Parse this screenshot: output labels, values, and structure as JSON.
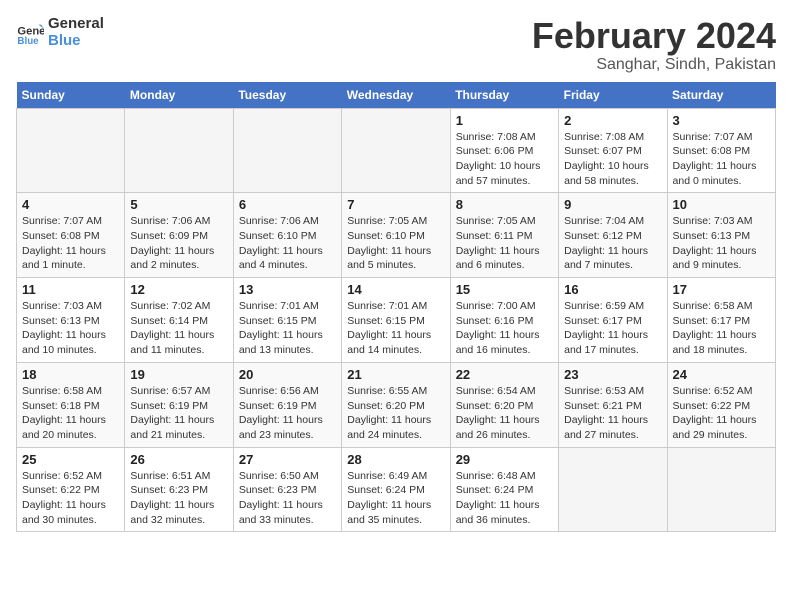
{
  "header": {
    "logo_line1": "General",
    "logo_line2": "Blue",
    "main_title": "February 2024",
    "subtitle": "Sanghar, Sindh, Pakistan"
  },
  "days_of_week": [
    "Sunday",
    "Monday",
    "Tuesday",
    "Wednesday",
    "Thursday",
    "Friday",
    "Saturday"
  ],
  "weeks": [
    [
      {
        "day": "",
        "empty": true
      },
      {
        "day": "",
        "empty": true
      },
      {
        "day": "",
        "empty": true
      },
      {
        "day": "",
        "empty": true
      },
      {
        "day": "1",
        "sunrise": "7:08 AM",
        "sunset": "6:06 PM",
        "daylight": "10 hours and 57 minutes."
      },
      {
        "day": "2",
        "sunrise": "7:08 AM",
        "sunset": "6:07 PM",
        "daylight": "10 hours and 58 minutes."
      },
      {
        "day": "3",
        "sunrise": "7:07 AM",
        "sunset": "6:08 PM",
        "daylight": "11 hours and 0 minutes."
      }
    ],
    [
      {
        "day": "4",
        "sunrise": "7:07 AM",
        "sunset": "6:08 PM",
        "daylight": "11 hours and 1 minute."
      },
      {
        "day": "5",
        "sunrise": "7:06 AM",
        "sunset": "6:09 PM",
        "daylight": "11 hours and 2 minutes."
      },
      {
        "day": "6",
        "sunrise": "7:06 AM",
        "sunset": "6:10 PM",
        "daylight": "11 hours and 4 minutes."
      },
      {
        "day": "7",
        "sunrise": "7:05 AM",
        "sunset": "6:10 PM",
        "daylight": "11 hours and 5 minutes."
      },
      {
        "day": "8",
        "sunrise": "7:05 AM",
        "sunset": "6:11 PM",
        "daylight": "11 hours and 6 minutes."
      },
      {
        "day": "9",
        "sunrise": "7:04 AM",
        "sunset": "6:12 PM",
        "daylight": "11 hours and 7 minutes."
      },
      {
        "day": "10",
        "sunrise": "7:03 AM",
        "sunset": "6:13 PM",
        "daylight": "11 hours and 9 minutes."
      }
    ],
    [
      {
        "day": "11",
        "sunrise": "7:03 AM",
        "sunset": "6:13 PM",
        "daylight": "11 hours and 10 minutes."
      },
      {
        "day": "12",
        "sunrise": "7:02 AM",
        "sunset": "6:14 PM",
        "daylight": "11 hours and 11 minutes."
      },
      {
        "day": "13",
        "sunrise": "7:01 AM",
        "sunset": "6:15 PM",
        "daylight": "11 hours and 13 minutes."
      },
      {
        "day": "14",
        "sunrise": "7:01 AM",
        "sunset": "6:15 PM",
        "daylight": "11 hours and 14 minutes."
      },
      {
        "day": "15",
        "sunrise": "7:00 AM",
        "sunset": "6:16 PM",
        "daylight": "11 hours and 16 minutes."
      },
      {
        "day": "16",
        "sunrise": "6:59 AM",
        "sunset": "6:17 PM",
        "daylight": "11 hours and 17 minutes."
      },
      {
        "day": "17",
        "sunrise": "6:58 AM",
        "sunset": "6:17 PM",
        "daylight": "11 hours and 18 minutes."
      }
    ],
    [
      {
        "day": "18",
        "sunrise": "6:58 AM",
        "sunset": "6:18 PM",
        "daylight": "11 hours and 20 minutes."
      },
      {
        "day": "19",
        "sunrise": "6:57 AM",
        "sunset": "6:19 PM",
        "daylight": "11 hours and 21 minutes."
      },
      {
        "day": "20",
        "sunrise": "6:56 AM",
        "sunset": "6:19 PM",
        "daylight": "11 hours and 23 minutes."
      },
      {
        "day": "21",
        "sunrise": "6:55 AM",
        "sunset": "6:20 PM",
        "daylight": "11 hours and 24 minutes."
      },
      {
        "day": "22",
        "sunrise": "6:54 AM",
        "sunset": "6:20 PM",
        "daylight": "11 hours and 26 minutes."
      },
      {
        "day": "23",
        "sunrise": "6:53 AM",
        "sunset": "6:21 PM",
        "daylight": "11 hours and 27 minutes."
      },
      {
        "day": "24",
        "sunrise": "6:52 AM",
        "sunset": "6:22 PM",
        "daylight": "11 hours and 29 minutes."
      }
    ],
    [
      {
        "day": "25",
        "sunrise": "6:52 AM",
        "sunset": "6:22 PM",
        "daylight": "11 hours and 30 minutes."
      },
      {
        "day": "26",
        "sunrise": "6:51 AM",
        "sunset": "6:23 PM",
        "daylight": "11 hours and 32 minutes."
      },
      {
        "day": "27",
        "sunrise": "6:50 AM",
        "sunset": "6:23 PM",
        "daylight": "11 hours and 33 minutes."
      },
      {
        "day": "28",
        "sunrise": "6:49 AM",
        "sunset": "6:24 PM",
        "daylight": "11 hours and 35 minutes."
      },
      {
        "day": "29",
        "sunrise": "6:48 AM",
        "sunset": "6:24 PM",
        "daylight": "11 hours and 36 minutes."
      },
      {
        "day": "",
        "empty": true
      },
      {
        "day": "",
        "empty": true
      }
    ]
  ]
}
